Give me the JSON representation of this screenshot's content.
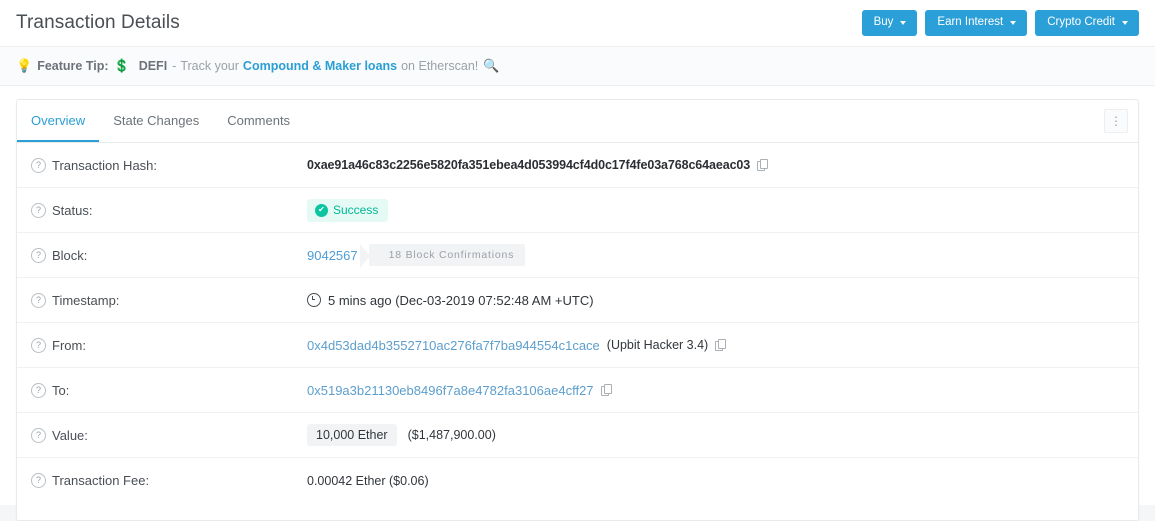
{
  "header": {
    "title": "Transaction Details",
    "buttons": [
      {
        "label": "Buy"
      },
      {
        "label": "Earn Interest"
      },
      {
        "label": "Crypto Credit"
      }
    ]
  },
  "tip": {
    "bulb_icon": "light-bulb-emoji",
    "bulb_glyph": "💡",
    "label": "Feature Tip:",
    "money_glyph": "💲",
    "defi": "DEFI",
    "dash": "-",
    "text_before": "Track your",
    "link": "Compound & Maker loans",
    "text_after": "on Etherscan!",
    "search_glyph": "🔍"
  },
  "tabs": {
    "items": [
      {
        "label": "Overview",
        "active": true
      },
      {
        "label": "State Changes",
        "active": false
      },
      {
        "label": "Comments",
        "active": false
      }
    ],
    "menu_glyph": "⋮"
  },
  "rows": {
    "hash": {
      "label": "Transaction Hash:",
      "value": "0xae91a46c83c2256e5820fa351ebea4d053994cf4d0c17f4fe03a768c64aeac03"
    },
    "status": {
      "label": "Status:",
      "value": "Success",
      "check_glyph": "✔"
    },
    "block": {
      "label": "Block:",
      "number": "9042567",
      "confirmations": "18 Block Confirmations"
    },
    "timestamp": {
      "label": "Timestamp:",
      "value": "5 mins ago (Dec-03-2019 07:52:48 AM +UTC)"
    },
    "from": {
      "label": "From:",
      "address": "0x4d53dad4b3552710ac276fa7f7ba944554c1cace",
      "note": "(Upbit Hacker 3.4)"
    },
    "to": {
      "label": "To:",
      "address": "0x519a3b21130eb8496f7a8e4782fa3106ae4cff27"
    },
    "value": {
      "label": "Value:",
      "amount": "10,000 Ether",
      "usd": "($1,487,900.00)"
    },
    "fee": {
      "label": "Transaction Fee:",
      "value": "0.00042 Ether ($0.06)"
    }
  },
  "help_glyph": "?",
  "colors": {
    "accent_blue": "#2a9fd6",
    "link_blue": "#5c9ece",
    "success_green": "#00b894",
    "success_bg": "#e6faf5",
    "pill_gray": "#f2f3f5"
  }
}
